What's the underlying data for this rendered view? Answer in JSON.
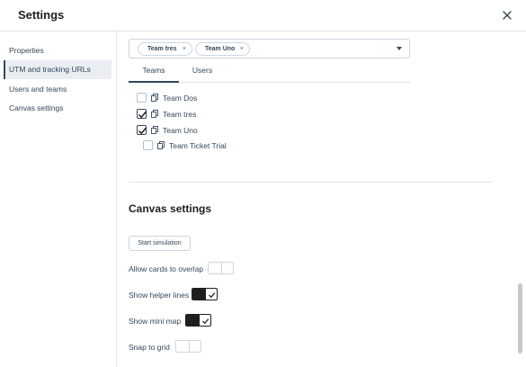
{
  "header": {
    "title": "Settings",
    "close_icon": "close-icon"
  },
  "sidebar": {
    "items": [
      {
        "label": "Properties",
        "active": false
      },
      {
        "label": "UTM and tracking URLs",
        "active": true
      },
      {
        "label": "Users and teams",
        "active": false
      },
      {
        "label": "Canvas settings",
        "active": false
      }
    ]
  },
  "team_select": {
    "tags": [
      {
        "label": "Team tres"
      },
      {
        "label": "Team Uno"
      }
    ],
    "caret_icon": "caret-down-icon"
  },
  "tabs": [
    {
      "label": "Teams",
      "active": true
    },
    {
      "label": "Users",
      "active": false
    }
  ],
  "teams": [
    {
      "label": "Team Dos",
      "checked": false,
      "indent": 0
    },
    {
      "label": "Team tres",
      "checked": true,
      "indent": 0
    },
    {
      "label": "Team Uno",
      "checked": true,
      "indent": 0
    },
    {
      "label": "Team Ticket Trial",
      "checked": false,
      "indent": 1
    }
  ],
  "canvas_settings": {
    "title": "Canvas settings",
    "simulation_button": "Start simulation",
    "options": [
      {
        "label": "Allow cards to overlap",
        "on": false
      },
      {
        "label": "Show helper lines",
        "on": true
      },
      {
        "label": "Show mini map",
        "on": true
      },
      {
        "label": "Snap to grid",
        "on": false
      }
    ]
  },
  "colors": {
    "text": "#33475b",
    "border": "#cbd6e2",
    "toggle_on": "#1f1f1f",
    "active_nav_bg": "#eaeef3"
  }
}
